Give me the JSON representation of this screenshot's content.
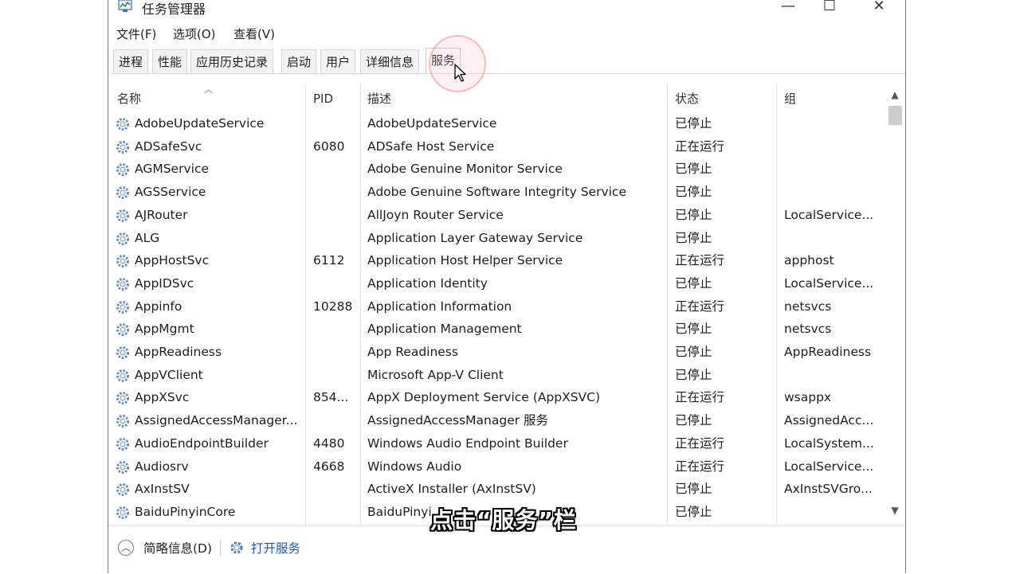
{
  "window": {
    "title": "任务管理器",
    "controls": {
      "minimize": "—",
      "maximize": "☐",
      "close": "✕"
    }
  },
  "menu": [
    "文件(F)",
    "选项(O)",
    "查看(V)"
  ],
  "tabs": [
    {
      "label": "进程",
      "active": false
    },
    {
      "label": "性能",
      "active": false
    },
    {
      "label": "应用历史记录",
      "active": false
    },
    {
      "label": "启动",
      "active": false
    },
    {
      "label": "用户",
      "active": false
    },
    {
      "label": "详细信息",
      "active": false
    },
    {
      "label": "服务",
      "active": true
    }
  ],
  "table": {
    "columns": {
      "name": "名称",
      "pid": "PID",
      "desc": "描述",
      "status": "状态",
      "group": "组"
    },
    "rows": [
      {
        "name": "AdobeUpdateService",
        "pid": "",
        "desc": "AdobeUpdateService",
        "status": "已停止",
        "group": ""
      },
      {
        "name": "ADSafeSvc",
        "pid": "6080",
        "desc": "ADSafe Host Service",
        "status": "正在运行",
        "group": ""
      },
      {
        "name": "AGMService",
        "pid": "",
        "desc": "Adobe Genuine Monitor Service",
        "status": "已停止",
        "group": ""
      },
      {
        "name": "AGSService",
        "pid": "",
        "desc": "Adobe Genuine Software Integrity Service",
        "status": "已停止",
        "group": ""
      },
      {
        "name": "AJRouter",
        "pid": "",
        "desc": "AllJoyn Router Service",
        "status": "已停止",
        "group": "LocalService..."
      },
      {
        "name": "ALG",
        "pid": "",
        "desc": "Application Layer Gateway Service",
        "status": "已停止",
        "group": ""
      },
      {
        "name": "AppHostSvc",
        "pid": "6112",
        "desc": "Application Host Helper Service",
        "status": "正在运行",
        "group": "apphost"
      },
      {
        "name": "AppIDSvc",
        "pid": "",
        "desc": "Application Identity",
        "status": "已停止",
        "group": "LocalService..."
      },
      {
        "name": "Appinfo",
        "pid": "10288",
        "desc": "Application Information",
        "status": "正在运行",
        "group": "netsvcs"
      },
      {
        "name": "AppMgmt",
        "pid": "",
        "desc": "Application Management",
        "status": "已停止",
        "group": "netsvcs"
      },
      {
        "name": "AppReadiness",
        "pid": "",
        "desc": "App Readiness",
        "status": "已停止",
        "group": "AppReadiness"
      },
      {
        "name": "AppVClient",
        "pid": "",
        "desc": "Microsoft App-V Client",
        "status": "已停止",
        "group": ""
      },
      {
        "name": "AppXSvc",
        "pid": "854...",
        "desc": "AppX Deployment Service (AppXSVC)",
        "status": "正在运行",
        "group": "wsappx"
      },
      {
        "name": "AssignedAccessManager...",
        "pid": "",
        "desc": "AssignedAccessManager 服务",
        "status": "已停止",
        "group": "AssignedAcc..."
      },
      {
        "name": "AudioEndpointBuilder",
        "pid": "4480",
        "desc": "Windows Audio Endpoint Builder",
        "status": "正在运行",
        "group": "LocalSystem..."
      },
      {
        "name": "Audiosrv",
        "pid": "4668",
        "desc": "Windows Audio",
        "status": "正在运行",
        "group": "LocalService..."
      },
      {
        "name": "AxInstSV",
        "pid": "",
        "desc": "ActiveX Installer (AxInstSV)",
        "status": "已停止",
        "group": "AxInstSVGro..."
      },
      {
        "name": "BaiduPinyinCore",
        "pid": "",
        "desc": "BaiduPinyi",
        "status": "已停止",
        "group": ""
      }
    ]
  },
  "footer": {
    "brief_label": "简略信息(D)",
    "open_services_label": "打开服务"
  },
  "subtitle": "点击“服务”栏",
  "colors": {
    "link": "#1f5bb5",
    "highlight": "#f07878"
  },
  "icons": {
    "service": "gear-icon",
    "collapse": "chevron-up-icon"
  }
}
